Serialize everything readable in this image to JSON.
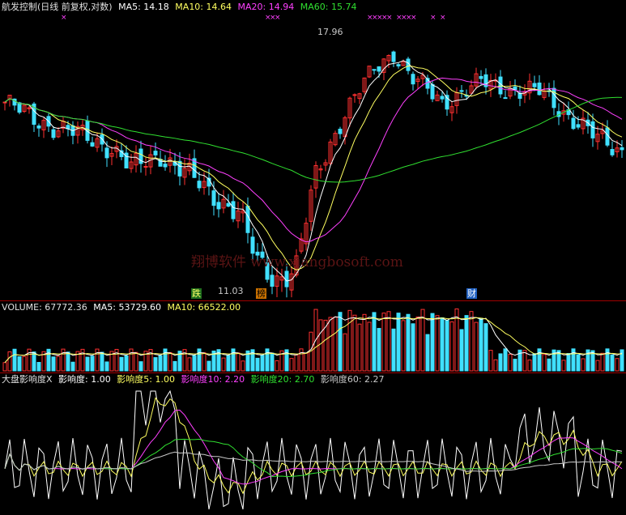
{
  "header": {
    "title": "航发控制(日线 前复权,对数)",
    "ma5": "MA5: 14.18",
    "ma10": "MA10: 14.64",
    "ma20": "MA20: 14.94",
    "ma60": "MA60: 15.74"
  },
  "volume_header": {
    "title": "VOLUME: 67772.36",
    "ma5": "MA5: 53729.60",
    "ma10": "MA10: 66522.00"
  },
  "indicator_header": {
    "title": "大盘影响度X",
    "v1": "影响度: 1.00",
    "v2": "影响度5: 1.00",
    "v3": "影响度10: 2.20",
    "v4": "影响度20: 2.70",
    "v5": "影响度60: 2.27"
  },
  "annotations": {
    "high": "17.96",
    "low": "11.03",
    "die": "跌",
    "bang": "榜",
    "cai": "财"
  },
  "watermark": "翔博软件 www.xiangbosoft.com",
  "colors": {
    "up": "#ff3030",
    "down": "#40e0ff",
    "ma5": "#ffffff",
    "ma10": "#ffff60",
    "ma20": "#ff40ff",
    "ma60": "#30e030",
    "separator": "#a00000"
  }
}
